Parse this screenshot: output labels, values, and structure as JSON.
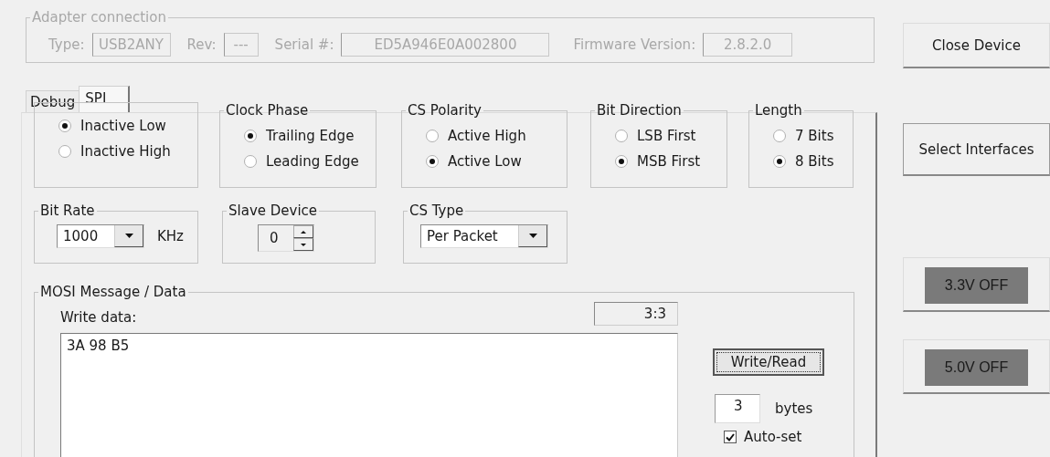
{
  "adapter": {
    "title": "Adapter connection",
    "disabled": true,
    "fields": [
      {
        "label": "Type:",
        "value": "USB2ANY"
      },
      {
        "label": "Rev:",
        "value": "---"
      },
      {
        "label": "Serial #:",
        "value": "ED5A946E0A002800"
      },
      {
        "label": "Firmware Version:",
        "value": "2.8.2.0"
      }
    ]
  },
  "tabs": [
    {
      "label": "Debug",
      "selected": false
    },
    {
      "label": "SPI",
      "selected": true
    }
  ],
  "option_groups": [
    {
      "options": [
        {
          "label": "Inactive Low",
          "selected": true
        },
        {
          "label": "Inactive High",
          "selected": false
        }
      ]
    },
    {
      "title": "Clock Phase",
      "options": [
        {
          "label": "Trailing Edge",
          "selected": true
        },
        {
          "label": "Leading Edge",
          "selected": false
        }
      ]
    },
    {
      "title": "CS Polarity",
      "options": [
        {
          "label": "Active High",
          "selected": false
        },
        {
          "label": "Active Low",
          "selected": true
        }
      ]
    },
    {
      "title": "Bit Direction",
      "options": [
        {
          "label": "LSB First",
          "selected": false
        },
        {
          "label": "MSB First",
          "selected": true
        }
      ]
    },
    {
      "title": "Length",
      "options": [
        {
          "label": "7 Bits",
          "selected": false
        },
        {
          "label": "8 Bits",
          "selected": true
        }
      ]
    }
  ],
  "bit_rate": {
    "title": "Bit Rate",
    "value": "1000",
    "unit": "KHz"
  },
  "slave_device": {
    "title": "Slave Device",
    "value": "0"
  },
  "cs_type": {
    "title": "CS Type",
    "value": "Per Packet"
  },
  "mosi": {
    "title": "MOSI Message / Data",
    "write_label": "Write data:",
    "counter": "3:3",
    "data": "3A 98 B5",
    "button": "Write/Read",
    "bytes_value": "3",
    "bytes_label": "bytes",
    "auto_set": {
      "label": "Auto-set",
      "checked": true
    }
  },
  "side_buttons": [
    {
      "kind": "button",
      "label": "Close Device"
    },
    {
      "kind": "button",
      "label": "Select Interfaces"
    },
    {
      "kind": "power",
      "label": "3.3V OFF",
      "on": false
    },
    {
      "kind": "power",
      "label": "5.0V OFF",
      "on": false
    }
  ]
}
